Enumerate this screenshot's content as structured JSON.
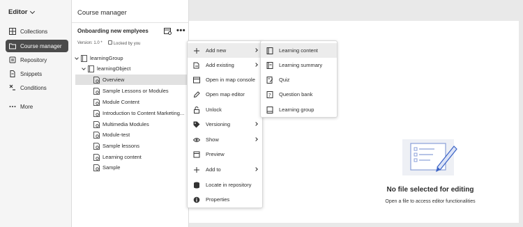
{
  "leftnav": {
    "title": "Editor",
    "items": [
      {
        "label": "Collections",
        "icon": "grid-icon"
      },
      {
        "label": "Course manager",
        "icon": "folder-icon",
        "active": true
      },
      {
        "label": "Repository",
        "icon": "repository-icon"
      },
      {
        "label": "Snippets",
        "icon": "snippet-icon"
      },
      {
        "label": "Conditions",
        "icon": "conditions-icon"
      },
      {
        "label": "More",
        "icon": "more-icon"
      }
    ]
  },
  "panel": {
    "title": "Course manager",
    "map_title": "Onboarding new emplyees",
    "version": "Version: 1.0 *",
    "lock_status": "Locked by you",
    "tree": [
      {
        "label": "learningGroup",
        "level": 0,
        "expand": true
      },
      {
        "label": "learningObject",
        "level": 1,
        "expand": true
      },
      {
        "label": "Overview",
        "level": 2,
        "selected": true
      },
      {
        "label": "Sample Lessons or Modules",
        "level": 2
      },
      {
        "label": "Module Content",
        "level": 2
      },
      {
        "label": "Introduction to Content Marketing...",
        "level": 2
      },
      {
        "label": "Multimedia Modules",
        "level": 2
      },
      {
        "label": "Module-test",
        "level": 2
      },
      {
        "label": "Sample lessons",
        "level": 2
      },
      {
        "label": "Learning content",
        "level": 2
      },
      {
        "label": "Sample",
        "level": 2
      }
    ]
  },
  "context_menu": {
    "items": [
      {
        "label": "Add new",
        "icon": "plus-icon",
        "submenu": true,
        "hover": true
      },
      {
        "label": "Add existing",
        "icon": "add-existing-icon",
        "submenu": true
      },
      {
        "label": "Open in map console",
        "icon": "map-console-icon"
      },
      {
        "label": "Open map editor",
        "icon": "pencil-icon"
      },
      {
        "label": "Unlock",
        "icon": "unlock-icon"
      },
      {
        "label": "Versioning",
        "icon": "tag-icon",
        "submenu": true
      },
      {
        "label": "Show",
        "icon": "eye-icon",
        "submenu": true
      },
      {
        "label": "Preview",
        "icon": "preview-icon"
      },
      {
        "label": "Add to",
        "icon": "plus-icon",
        "submenu": true
      },
      {
        "label": "Locate in repository",
        "icon": "database-icon"
      },
      {
        "label": "Properties",
        "icon": "info-icon"
      }
    ]
  },
  "submenu": {
    "items": [
      {
        "label": "Learning content",
        "icon": "learning-content-icon",
        "hover": true
      },
      {
        "label": "Learning summary",
        "icon": "learning-summary-icon"
      },
      {
        "label": "Quiz",
        "icon": "quiz-icon"
      },
      {
        "label": "Question bank",
        "icon": "question-bank-icon"
      },
      {
        "label": "Learning group",
        "icon": "learning-group-icon"
      }
    ]
  },
  "empty_state": {
    "title": "No file selected for editing",
    "subtitle": "Open a file to access editor functionalities",
    "icon": "empty-editor-illustration"
  },
  "colors": {
    "nav_active": "#4b4b4b",
    "hover": "#ececec",
    "illustration_blue": "#3b63c6"
  }
}
